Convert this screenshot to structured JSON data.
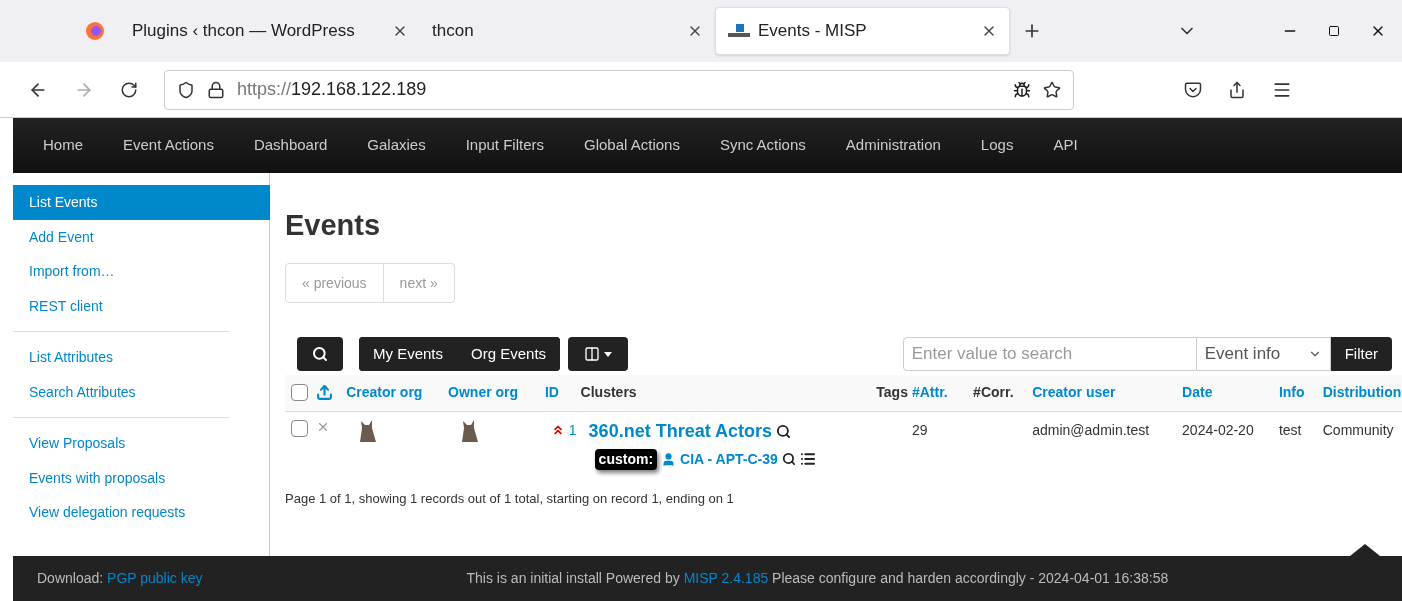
{
  "browser": {
    "tabs": [
      {
        "title": "Plugins ‹ thcon — WordPress",
        "selected": false,
        "kind": "plain"
      },
      {
        "title": "thcon",
        "selected": false,
        "kind": "plain"
      },
      {
        "title": "Events - MISP",
        "selected": true,
        "kind": "misp"
      }
    ],
    "url_scheme": "https://",
    "url_host": "192.168.122.189"
  },
  "navbar": {
    "items": [
      "Home",
      "Event Actions",
      "Dashboard",
      "Galaxies",
      "Input Filters",
      "Global Actions",
      "Sync Actions",
      "Administration",
      "Logs",
      "API"
    ]
  },
  "sidebar": {
    "groups": [
      [
        {
          "label": "List Events",
          "selected": true
        },
        {
          "label": "Add Event",
          "selected": false
        },
        {
          "label": "Import from…",
          "selected": false
        },
        {
          "label": "REST client",
          "selected": false
        }
      ],
      [
        {
          "label": "List Attributes",
          "selected": false
        },
        {
          "label": "Search Attributes",
          "selected": false
        }
      ],
      [
        {
          "label": "View Proposals",
          "selected": false
        },
        {
          "label": "Events with proposals",
          "selected": false
        },
        {
          "label": "View delegation requests",
          "selected": false
        }
      ]
    ]
  },
  "content": {
    "title": "Events",
    "pagination": [
      {
        "label": "« previous",
        "disabled": true
      },
      {
        "label": "next »",
        "disabled": true
      }
    ],
    "filter_buttons": [
      "My Events",
      "Org Events"
    ],
    "search": {
      "placeholder": "Enter value to search"
    },
    "search_field_select": "Event info",
    "filter_button": "Filter",
    "table": {
      "select_all_checked": false,
      "columns": [
        {
          "label": "Creator org",
          "sortable": true
        },
        {
          "label": "Owner org",
          "sortable": true
        },
        {
          "label": "ID",
          "sortable": true
        },
        {
          "label": "Clusters",
          "sortable": false
        },
        {
          "label": "Tags",
          "sortable": false
        },
        {
          "label": "#Attr.",
          "sortable": true
        },
        {
          "label": "#Corr.",
          "sortable": false
        },
        {
          "label": "Creator user",
          "sortable": true
        },
        {
          "label": "Date",
          "sortable": true
        },
        {
          "label": "Info",
          "sortable": true
        },
        {
          "label": "Distribution",
          "sortable": true
        }
      ],
      "rows": [
        {
          "checked": false,
          "published": false,
          "threat_high": true,
          "id": "1",
          "cluster": "360.net Threat Actors",
          "tag_prefix": "custom:",
          "tag_cluster": "CIA - APT-C-39",
          "attributes": "29",
          "creator_user": "admin@admin.test",
          "date": "2024-02-20",
          "info": "test",
          "distribution": "Community"
        }
      ]
    },
    "page_summary": "Page 1 of 1, showing 1 records out of 1 total, starting on record 1, ending on 1"
  },
  "footer": {
    "download_label": "Download:",
    "download_link": "PGP public key",
    "notice_before": "This is an initial install Powered by",
    "notice_link": "MISP 2.4.185",
    "notice_after": "Please configure and harden accordingly - 2024-04-01 16:38:58"
  }
}
